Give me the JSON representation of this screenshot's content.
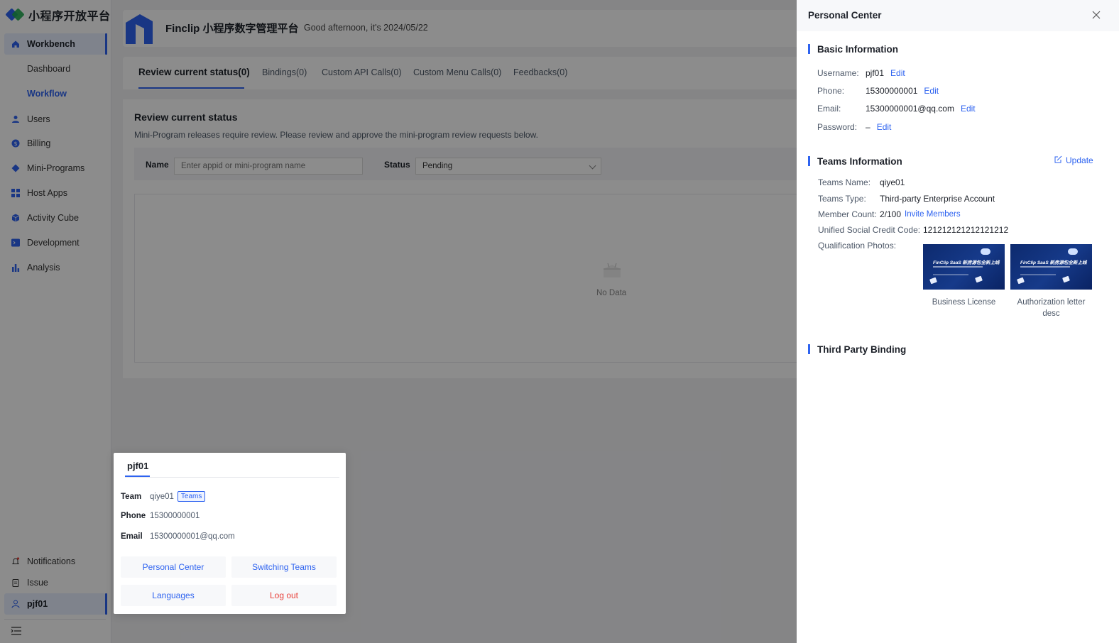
{
  "sidebar": {
    "logo_text": "小程序开放平台",
    "items": [
      {
        "label": "Workbench",
        "icon": "home-icon"
      },
      {
        "label": "Dashboard"
      },
      {
        "label": "Workflow"
      },
      {
        "label": "Users",
        "icon": "user-icon"
      },
      {
        "label": "Billing",
        "icon": "billing-icon"
      },
      {
        "label": "Mini-Programs",
        "icon": "diamond-icon"
      },
      {
        "label": "Host Apps",
        "icon": "grid-icon"
      },
      {
        "label": "Activity Cube",
        "icon": "cube-icon"
      },
      {
        "label": "Development",
        "icon": "terminal-icon"
      },
      {
        "label": "Analysis",
        "icon": "bar-chart-icon"
      }
    ],
    "bottom": [
      {
        "label": "Notifications",
        "icon": "bell-icon"
      },
      {
        "label": "Issue",
        "icon": "clipboard-icon"
      },
      {
        "label": "pjf01",
        "icon": "user-outline-icon"
      }
    ]
  },
  "header": {
    "title": "Finclip 小程序数字管理平台",
    "greeting": "Good afternoon, it's  2024/05/22"
  },
  "tabs": [
    "Review current status(0)",
    "Bindings(0)",
    "Custom API Calls(0)",
    "Custom Menu Calls(0)",
    "Feedbacks(0)"
  ],
  "review": {
    "title": "Review current status",
    "description": "Mini-Program releases require review. Please review and approve the mini-program review requests below.",
    "name_label": "Name",
    "name_placeholder": "Enter appid or mini-program name",
    "status_label": "Status",
    "status_value": "Pending",
    "empty_text": "No Data"
  },
  "popover": {
    "tab": "pjf01",
    "team_label": "Team",
    "team_value": "qiye01",
    "team_badge": "Teams",
    "phone_label": "Phone",
    "phone_value": "15300000001",
    "email_label": "Email",
    "email_value": "15300000001@qq.com",
    "buttons": [
      "Personal Center",
      "Switching Teams",
      "Languages",
      "Log out"
    ]
  },
  "drawer": {
    "title": "Personal Center",
    "basic": {
      "title": "Basic Information",
      "edit": "Edit",
      "rows": [
        {
          "label": "Username:",
          "value": "pjf01"
        },
        {
          "label": "Phone:",
          "value": "15300000001"
        },
        {
          "label": "Email:",
          "value": "15300000001@qq.com"
        },
        {
          "label": "Password:",
          "value": "–"
        }
      ]
    },
    "teams": {
      "title": "Teams Information",
      "update": "Update",
      "name_label": "Teams Name:",
      "name_value": "qiye01",
      "type_label": "Teams Type:",
      "type_value": "Third-party Enterprise Account",
      "count_label": "Member Count:",
      "count_value": "2/100",
      "invite": "Invite Members",
      "credit_label": "Unified Social Credit Code:",
      "credit_value": "121212121212121212",
      "photos_label": "Qualification Photos:",
      "photo_headline": "FinClip SaaS 新房源包全新上线",
      "photos": [
        "Business License",
        "Authorization letter desc"
      ]
    },
    "third_party": {
      "title": "Third Party Binding"
    }
  },
  "colors": {
    "accent": "#2e63f0",
    "danger": "#e8413a",
    "logo_green": "#1fa84f"
  }
}
